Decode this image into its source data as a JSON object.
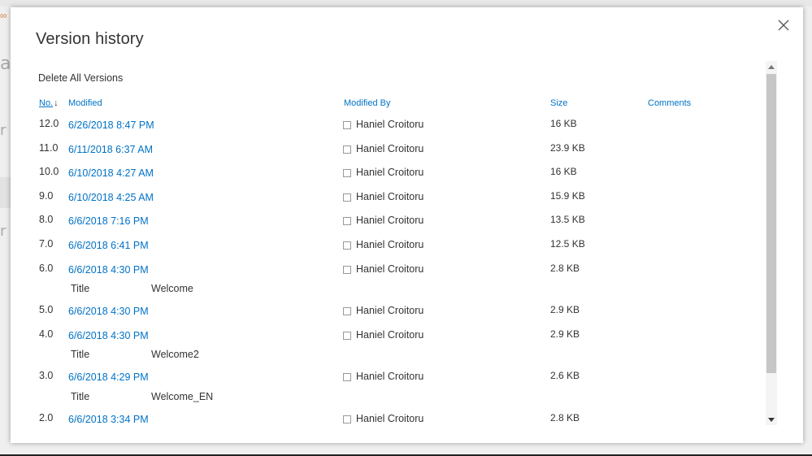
{
  "dialog": {
    "title": "Version history",
    "delete_all_label": "Delete All Versions"
  },
  "columns": {
    "no": "No.",
    "modified": "Modified",
    "modified_by": "Modified By",
    "size": "Size",
    "comments": "Comments"
  },
  "sort_indicator": "↓",
  "versions": [
    {
      "no": "12.0",
      "modified": "6/26/2018 8:47 PM",
      "modified_by": "Haniel Croitoru",
      "size": "16 KB"
    },
    {
      "no": "11.0",
      "modified": "6/11/2018 6:37 AM",
      "modified_by": "Haniel Croitoru",
      "size": "23.9 KB"
    },
    {
      "no": "10.0",
      "modified": "6/10/2018 4:27 AM",
      "modified_by": "Haniel Croitoru",
      "size": "16 KB"
    },
    {
      "no": "9.0",
      "modified": "6/10/2018 4:25 AM",
      "modified_by": "Haniel Croitoru",
      "size": "15.9 KB"
    },
    {
      "no": "8.0",
      "modified": "6/6/2018 7:16 PM",
      "modified_by": "Haniel Croitoru",
      "size": "13.5 KB"
    },
    {
      "no": "7.0",
      "modified": "6/6/2018 6:41 PM",
      "modified_by": "Haniel Croitoru",
      "size": "12.5 KB"
    },
    {
      "no": "6.0",
      "modified": "6/6/2018 4:30 PM",
      "modified_by": "Haniel Croitoru",
      "size": "2.8 KB",
      "change": {
        "label": "Title",
        "value": "Welcome"
      }
    },
    {
      "no": "5.0",
      "modified": "6/6/2018 4:30 PM",
      "modified_by": "Haniel Croitoru",
      "size": "2.9 KB"
    },
    {
      "no": "4.0",
      "modified": "6/6/2018 4:30 PM",
      "modified_by": "Haniel Croitoru",
      "size": "2.9 KB",
      "change": {
        "label": "Title",
        "value": "Welcome2"
      }
    },
    {
      "no": "3.0",
      "modified": "6/6/2018 4:29 PM",
      "modified_by": "Haniel Croitoru",
      "size": "2.6 KB",
      "change": {
        "label": "Title",
        "value": "Welcome_EN"
      }
    },
    {
      "no": "2.0",
      "modified": "6/6/2018 3:34 PM",
      "modified_by": "Haniel Croitoru",
      "size": "2.8 KB"
    }
  ],
  "colors": {
    "link": "#0072c6",
    "text": "#333333",
    "scroll_thumb": "#c6c6c6"
  },
  "icons": {
    "close": "close-icon",
    "sort": "sort-descending-icon",
    "scroll_up": "scroll-up-arrow-icon",
    "scroll_down": "scroll-down-arrow-icon",
    "presence": "presence-checkbox-icon"
  }
}
